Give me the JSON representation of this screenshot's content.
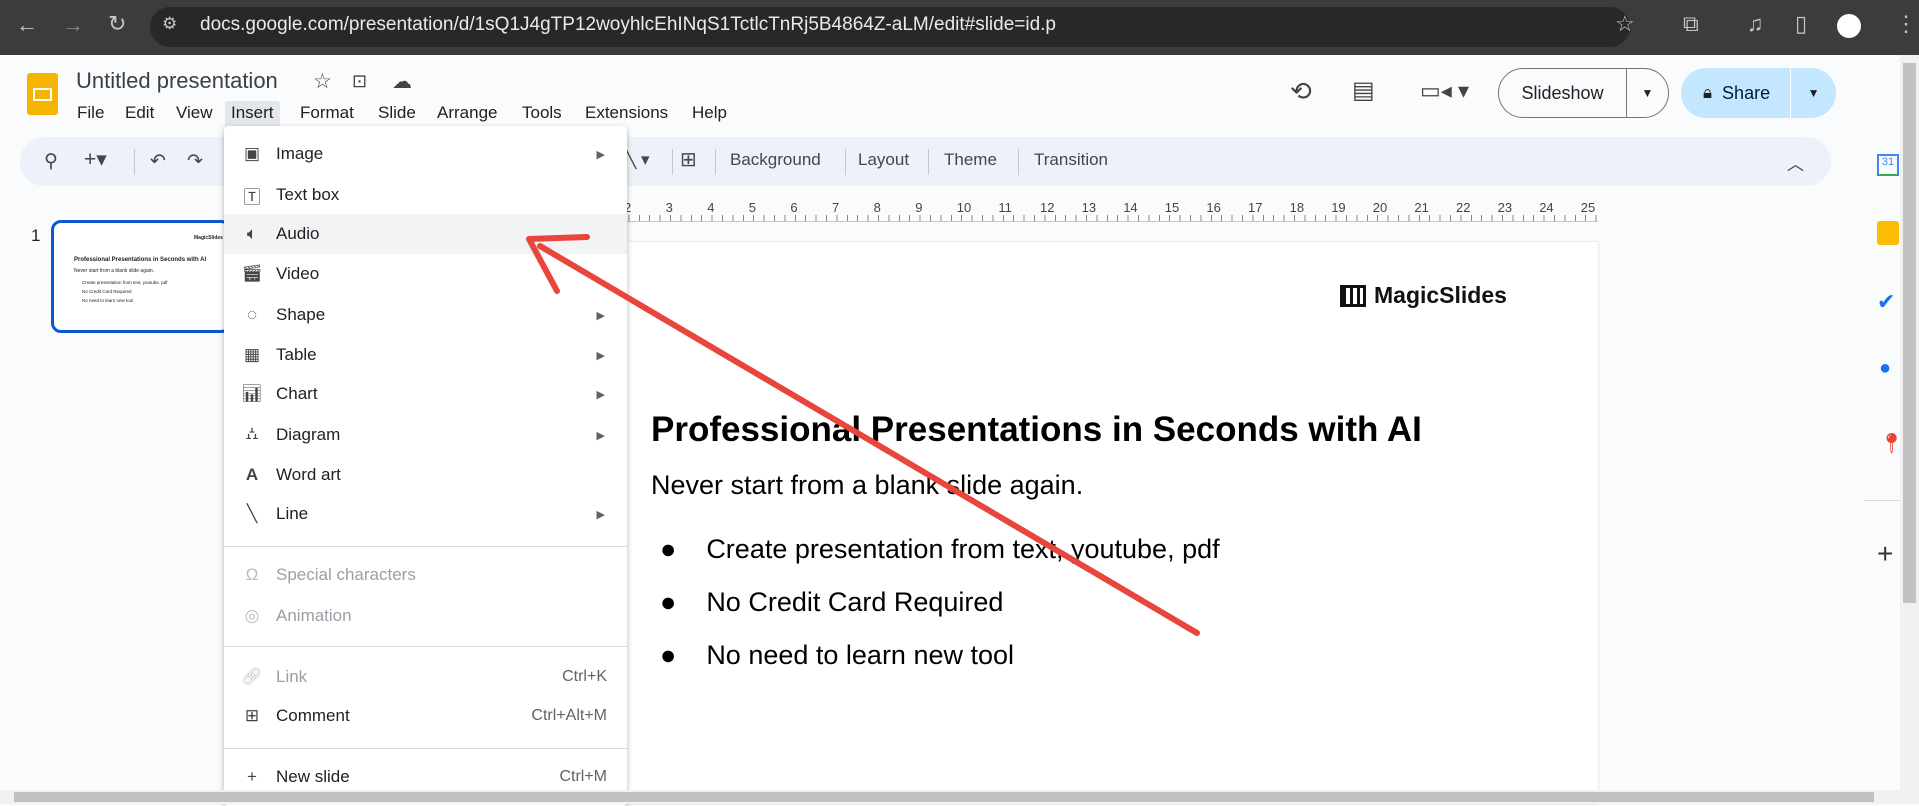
{
  "browser": {
    "url": "docs.google.com/presentation/d/1sQ1J4gTP12woyhlcEhINqS1TctlcTnRj5B4864Z-aLM/edit#slide=id.p"
  },
  "doc": {
    "title": "Untitled presentation"
  },
  "menubar": [
    "File",
    "Edit",
    "View",
    "Insert",
    "Format",
    "Slide",
    "Arrange",
    "Tools",
    "Extensions",
    "Help"
  ],
  "header": {
    "slideshow": "Slideshow",
    "share": "Share"
  },
  "toolbar": {
    "background": "Background",
    "layout": "Layout",
    "theme": "Theme",
    "transition": "Transition"
  },
  "ruler": [
    "2",
    "3",
    "4",
    "5",
    "6",
    "7",
    "8",
    "9",
    "10",
    "11",
    "12",
    "13",
    "14",
    "15",
    "16",
    "17",
    "18",
    "19",
    "20",
    "21",
    "22",
    "23",
    "24",
    "25"
  ],
  "filmstrip": {
    "number": "1"
  },
  "insert_menu": {
    "items": [
      {
        "label": "Image",
        "submenu": true
      },
      {
        "label": "Text box"
      },
      {
        "label": "Audio"
      },
      {
        "label": "Video"
      },
      {
        "label": "Shape",
        "submenu": true
      },
      {
        "label": "Table",
        "submenu": true
      },
      {
        "label": "Chart",
        "submenu": true
      },
      {
        "label": "Diagram",
        "submenu": true
      },
      {
        "label": "Word art"
      },
      {
        "label": "Line",
        "submenu": true
      }
    ],
    "disabled": [
      {
        "label": "Special characters"
      },
      {
        "label": "Animation"
      }
    ],
    "more": [
      {
        "label": "Link",
        "shortcut": "Ctrl+K"
      },
      {
        "label": "Comment",
        "shortcut": "Ctrl+Alt+M"
      }
    ],
    "last": {
      "label": "New slide",
      "shortcut": "Ctrl+M"
    }
  },
  "slide": {
    "logo": "MagicSlides",
    "title": "Professional Presentations in Seconds with AI",
    "subtitle": "Never start from a blank slide again.",
    "bullets": [
      "Create presentation from text, youtube, pdf",
      "No Credit Card Required",
      "No need to learn new tool"
    ]
  },
  "colors": {
    "accent": "#0b57d0",
    "share_bg": "#c2e7ff",
    "arrow": "#e8453c"
  }
}
